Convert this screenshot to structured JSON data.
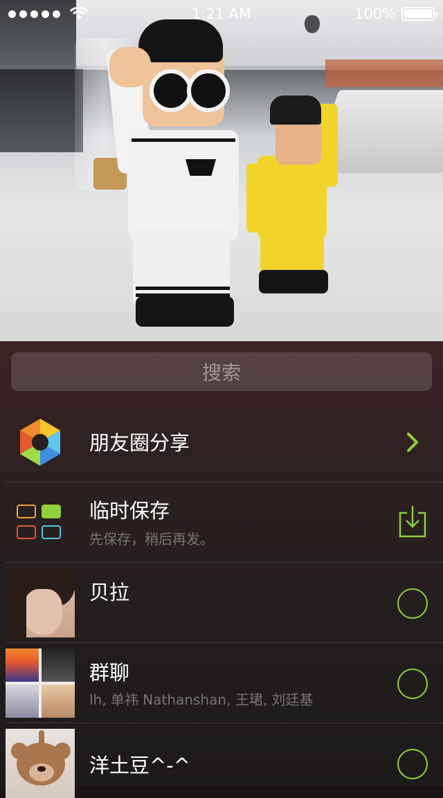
{
  "status_bar": {
    "time": "1:21 AM",
    "battery": "100%",
    "battery_level": 1.0
  },
  "search": {
    "placeholder": "搜索"
  },
  "rows": [
    {
      "title": "朋友圈分享",
      "icon": "moments-aperture-icon",
      "accessory": "chevron-right-icon"
    },
    {
      "title": "临时保存",
      "subtitle": "先保存，稍后再发。",
      "icon": "temp-save-grid-icon",
      "accessory": "download-icon"
    },
    {
      "title": "贝拉",
      "avatar": "avatar-bella",
      "accessory": "check-circle-icon"
    },
    {
      "title": "群聊",
      "subtitle": "lh, 单祎 Nathanshan, 王珺, 刘廷基",
      "avatar": "avatar-group",
      "accessory": "check-circle-icon"
    },
    {
      "title": "洋土豆^-^",
      "avatar": "avatar-bear",
      "accessory": "check-circle-icon"
    }
  ],
  "colors": {
    "accent": "#8ed13a",
    "sheet_top": "#3b2424",
    "sheet_bottom": "#1d1a1a"
  }
}
